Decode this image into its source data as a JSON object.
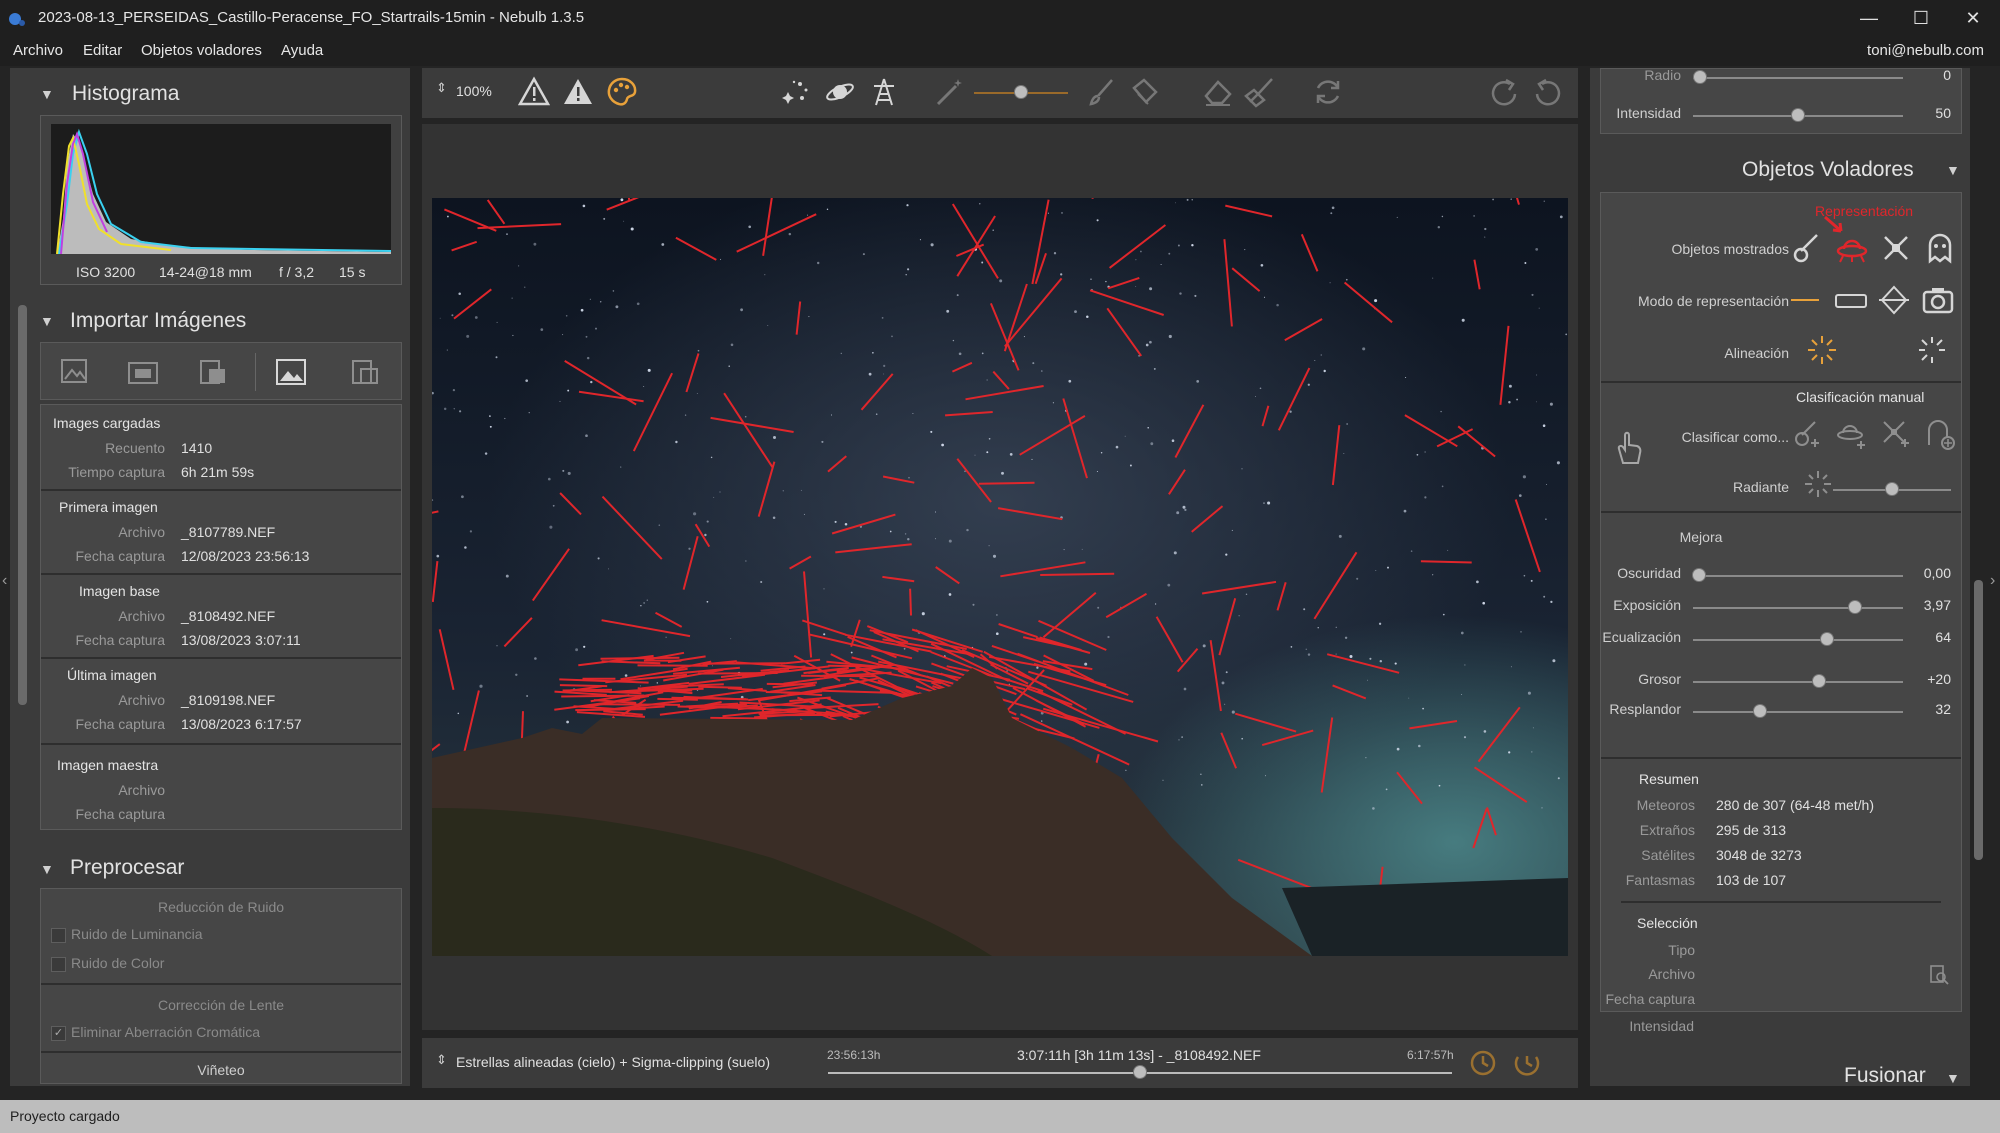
{
  "window": {
    "title": "2023-08-13_PERSEIDAS_Castillo-Peracense_FO_Startrails-15min - Nebulb 1.3.5",
    "minimize": "—",
    "maximize": "☐",
    "close": "✕"
  },
  "menu": {
    "items": [
      "Archivo",
      "Editar",
      "Objetos voladores",
      "Ayuda"
    ],
    "user": "toni@nebulb.com"
  },
  "histogram": {
    "title": "Histograma",
    "iso": "ISO 3200",
    "lens": "14-24@18 mm",
    "aperture": "f / 3,2",
    "exposure": "15 s"
  },
  "import": {
    "title": "Importar Imágenes",
    "loaded": {
      "header": "Images cargadas",
      "count_label": "Recuento",
      "count": "1410",
      "time_label": "Tiempo captura",
      "time": "6h 21m 59s"
    },
    "first": {
      "header": "Primera imagen",
      "file_label": "Archivo",
      "file": "_8107789.NEF",
      "date_label": "Fecha captura",
      "date": "12/08/2023 23:56:13"
    },
    "base": {
      "header": "Imagen base",
      "file_label": "Archivo",
      "file": "_8108492.NEF",
      "date_label": "Fecha captura",
      "date": "13/08/2023 3:07:11"
    },
    "last": {
      "header": "Última imagen",
      "file_label": "Archivo",
      "file": "_8109198.NEF",
      "date_label": "Fecha captura",
      "date": "13/08/2023 6:17:57"
    },
    "master": {
      "header": "Imagen maestra",
      "file_label": "Archivo",
      "date_label": "Fecha captura"
    }
  },
  "preprocess": {
    "title": "Preprocesar",
    "noise_header": "Reducción de Ruido",
    "luminance": "Ruido de Luminancia",
    "color": "Ruido de Color",
    "lens_header": "Corrección de Lente",
    "chromatic": "Eliminar Aberración Cromática",
    "vignette": "Viñeteo"
  },
  "toolbar": {
    "zoom": "100%"
  },
  "timeline": {
    "mode": "Estrellas alineadas (cielo) + Sigma-clipping (suelo)",
    "start": "23:56:13h",
    "current": "3:07:11h [3h 11m 13s] - _8108492.NEF",
    "end": "6:17:57h",
    "position": 0.5
  },
  "right": {
    "top_partial_label": "Radio",
    "top_partial_value": "0",
    "intensity_label": "Intensidad",
    "intensity_value": "50",
    "title": "Objetos Voladores",
    "representation": "Representación",
    "shown_objects": "Objetos mostrados",
    "mode": "Modo de representación",
    "alignment": "Alineación",
    "manual_header": "Clasificación manual",
    "classify": "Clasificar como...",
    "radiant": "Radiante",
    "improve": "Mejora",
    "sliders": [
      {
        "label": "Oscuridad",
        "value": "0,00",
        "pos": 0.03
      },
      {
        "label": "Exposición",
        "value": "3,97",
        "pos": 0.77
      },
      {
        "label": "Ecualización",
        "value": "64",
        "pos": 0.64
      },
      {
        "label": "Grosor",
        "value": "+20",
        "pos": 0.6
      },
      {
        "label": "Resplandor",
        "value": "32",
        "pos": 0.32
      }
    ],
    "summary": {
      "header": "Resumen",
      "meteors_label": "Meteoros",
      "meteors": "280 de 307 (64-48 met/h)",
      "strange_label": "Extraños",
      "strange": "295 de 313",
      "sat_label": "Satélites",
      "sat": "3048 de 3273",
      "ghost_label": "Fantasmas",
      "ghost": "103 de 107"
    },
    "selection": {
      "header": "Selección",
      "type_label": "Tipo",
      "file_label": "Archivo",
      "date_label": "Fecha captura",
      "intensity_label": "Intensidad"
    },
    "merge": "Fusionar"
  },
  "status": "Proyecto cargado",
  "colors": {
    "accent": "#e8a13a",
    "meteor": "#e0262b",
    "panel": "#3b3b3b"
  }
}
